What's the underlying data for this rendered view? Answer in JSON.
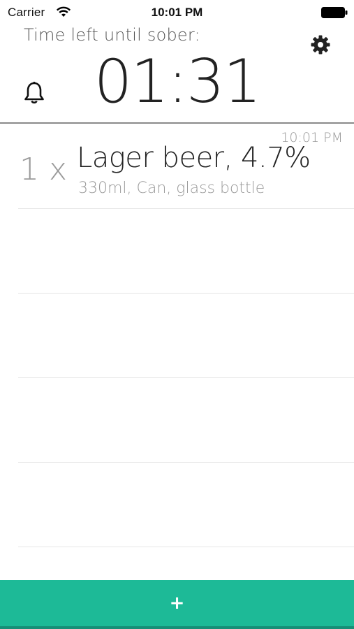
{
  "status_bar": {
    "carrier": "Carrier",
    "time": "10:01 PM"
  },
  "header": {
    "label": "Time left until sober:",
    "timer": "01:31"
  },
  "drinks": [
    {
      "time": "10:01 PM",
      "quantity": "1 x",
      "name": "Lager beer, 4.7%",
      "detail": "330ml, Can, glass bottle"
    }
  ],
  "add_button": {
    "label": "+"
  },
  "icons": {
    "wifi": "wifi-icon",
    "battery": "battery-icon",
    "settings": "gear-icon",
    "alarm": "bell-icon"
  },
  "colors": {
    "accent": "#1dba97",
    "muted_text": "#9a9a9a",
    "divider": "#8a8a8a"
  }
}
